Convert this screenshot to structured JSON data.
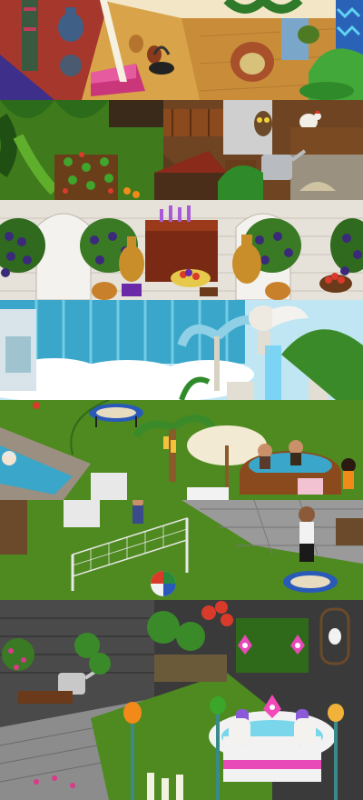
{
  "collage": {
    "panels": [
      {
        "id": "bazaar-room"
      },
      {
        "id": "farm-garden-room"
      },
      {
        "id": "market-stall-room"
      },
      {
        "id": "cloud-waterfall-room"
      },
      {
        "id": "park-pool-room"
      },
      {
        "id": "volleyball-yard-room"
      },
      {
        "id": "flower-garden-carousel-room"
      }
    ]
  },
  "colors": {
    "grass": "#4e8a1f",
    "grass_dark": "#355f12",
    "stone": "#8c8c8c",
    "wood": "#8b4a1e",
    "water": "#3aa6c9",
    "sky": "#bfe6f2",
    "tile_light": "#e6e2da",
    "carpet": "#c23a5c"
  },
  "icons": [
    "vase-icon",
    "pot-icon",
    "owl-icon",
    "chicken-icon",
    "watering-can-icon",
    "grapevine-icon",
    "fruit-basket-icon",
    "amphora-icon",
    "angel-statue-icon",
    "palm-tree-icon",
    "trampoline-icon",
    "umbrella-icon",
    "hot-tub-icon",
    "volleyball-net-icon",
    "beach-ball-icon",
    "avatar-icon",
    "lotus-lamp-icon",
    "carousel-horse-icon",
    "birdcage-icon"
  ]
}
